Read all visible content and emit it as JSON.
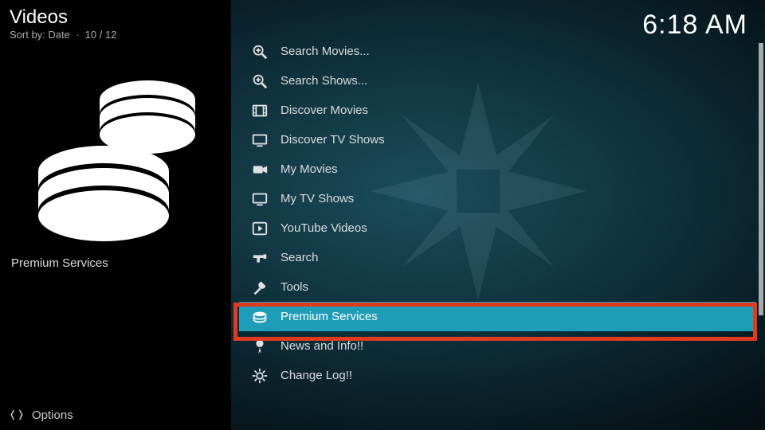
{
  "header": {
    "title": "Videos",
    "sort_prefix": "Sort by: ",
    "sort_value": "Date",
    "counter": "10 / 12",
    "clock": "6:18 AM"
  },
  "sidebar": {
    "current_item_label": "Premium Services",
    "options_label": "Options"
  },
  "menu": {
    "items": [
      {
        "label": "Search Movies...",
        "icon": "search-zoom",
        "selected": false
      },
      {
        "label": "Search Shows...",
        "icon": "search-zoom",
        "selected": false
      },
      {
        "label": "Discover Movies",
        "icon": "film",
        "selected": false
      },
      {
        "label": "Discover TV Shows",
        "icon": "tv",
        "selected": false
      },
      {
        "label": "My Movies",
        "icon": "camera",
        "selected": false
      },
      {
        "label": "My TV Shows",
        "icon": "tv",
        "selected": false
      },
      {
        "label": "YouTube Videos",
        "icon": "play-box",
        "selected": false
      },
      {
        "label": "Search",
        "icon": "blaster",
        "selected": false
      },
      {
        "label": "Tools",
        "icon": "tools",
        "selected": false
      },
      {
        "label": "Premium Services",
        "icon": "coins",
        "selected": true
      },
      {
        "label": "News and Info!!",
        "icon": "pin",
        "selected": false
      },
      {
        "label": "Change Log!!",
        "icon": "gear",
        "selected": false
      }
    ]
  },
  "colors": {
    "accent": "#1d9db8",
    "highlight_border": "#e13a1e"
  }
}
